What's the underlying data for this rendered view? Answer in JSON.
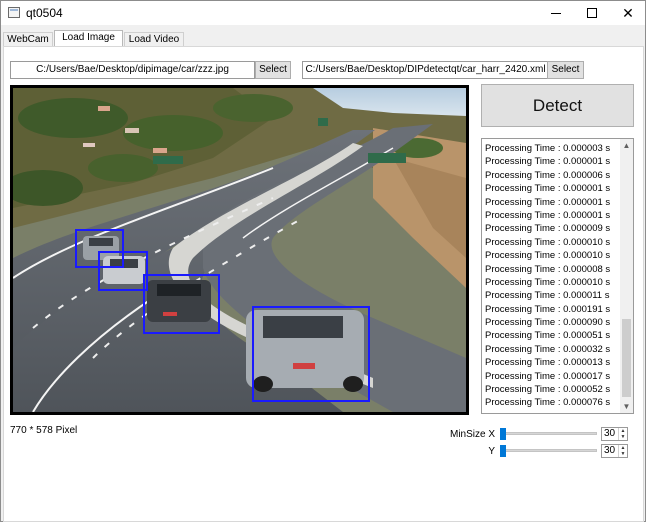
{
  "window": {
    "title": "qt0504",
    "minimize_glyph": "minimize-icon",
    "maximize_glyph": "maximize-icon",
    "close_glyph": "✕"
  },
  "tabs": [
    {
      "label": "WebCam",
      "active": false
    },
    {
      "label": "Load Image",
      "active": true
    },
    {
      "label": "Load Video",
      "active": false
    }
  ],
  "image_path": {
    "value": "C:/Users/Bae/Desktop/dipimage/car/zzz.jpg",
    "button": "Select"
  },
  "xml_path": {
    "value": "C:/Users/Bae/Desktop/DIPdetectqt/car_harr_2420.xml",
    "button": "Select"
  },
  "detect_button": "Detect",
  "log": [
    "Processing Time : 0.000003 s",
    "Processing Time : 0.000001 s",
    "Processing Time : 0.000006 s",
    "Processing Time : 0.000001 s",
    "Processing Time : 0.000001 s",
    "Processing Time : 0.000001 s",
    "Processing Time : 0.000009 s",
    "Processing Time : 0.000010 s",
    "Processing Time : 0.000010 s",
    "Processing Time : 0.000008 s",
    "Processing Time : 0.000010 s",
    "Processing Time : 0.000011 s",
    "Processing Time : 0.000191 s",
    "Processing Time : 0.000090 s",
    "Processing Time : 0.000051 s",
    "Processing Time : 0.000032 s",
    "Processing Time : 0.000013 s",
    "Processing Time : 0.000017 s",
    "Processing Time : 0.000052 s",
    "Processing Time : 0.000076 s"
  ],
  "image_info": "770 * 578 Pixel",
  "min_size": {
    "x_label": "MinSize X",
    "y_label": "Y",
    "x_value": "30",
    "y_value": "30"
  },
  "colors": {
    "accent": "#0078d7",
    "detection_box": "#1a1aff"
  },
  "icons": {
    "app": "window-app-icon",
    "scroll_up": "chevron-up-icon",
    "scroll_down": "chevron-down-icon",
    "spin": "spin-arrows-icon"
  }
}
